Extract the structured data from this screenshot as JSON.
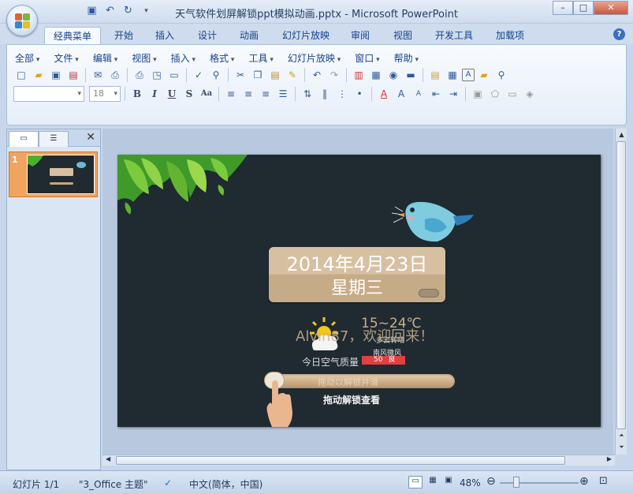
{
  "window": {
    "title": "天气软件划屏解锁ppt模拟动画.pptx - Microsoft PowerPoint",
    "controls": {
      "minimize": "–",
      "maximize": "□",
      "close": "✕"
    }
  },
  "ribbon_tabs": [
    "经典菜单",
    "开始",
    "插入",
    "设计",
    "动画",
    "幻灯片放映",
    "审阅",
    "视图",
    "开发工具",
    "加载项"
  ],
  "menu": [
    "全部",
    "文件",
    "编辑",
    "视图",
    "插入",
    "格式",
    "工具",
    "幻灯片放映",
    "窗口",
    "帮助"
  ],
  "font_size": "18",
  "slide": {
    "date": "2014年4月23日",
    "weekday": "星期三",
    "temperature": "15~24℃",
    "weather": "多云转晴",
    "wind": "南风微风",
    "welcome": "Alvin87，欢迎回来！",
    "air_quality_label": "今日空气质量",
    "aqi_value": "50",
    "aqi_level": "良",
    "slider_hint": "拖动以解锁并滑",
    "unlock_label": "拖动解锁查看"
  },
  "thumbnail": {
    "number": "1"
  },
  "status": {
    "slide_count": "幻灯片 1/1",
    "theme": "\"3_Office 主题\"",
    "language": "中文(简体，中国)",
    "zoom": "48%"
  }
}
